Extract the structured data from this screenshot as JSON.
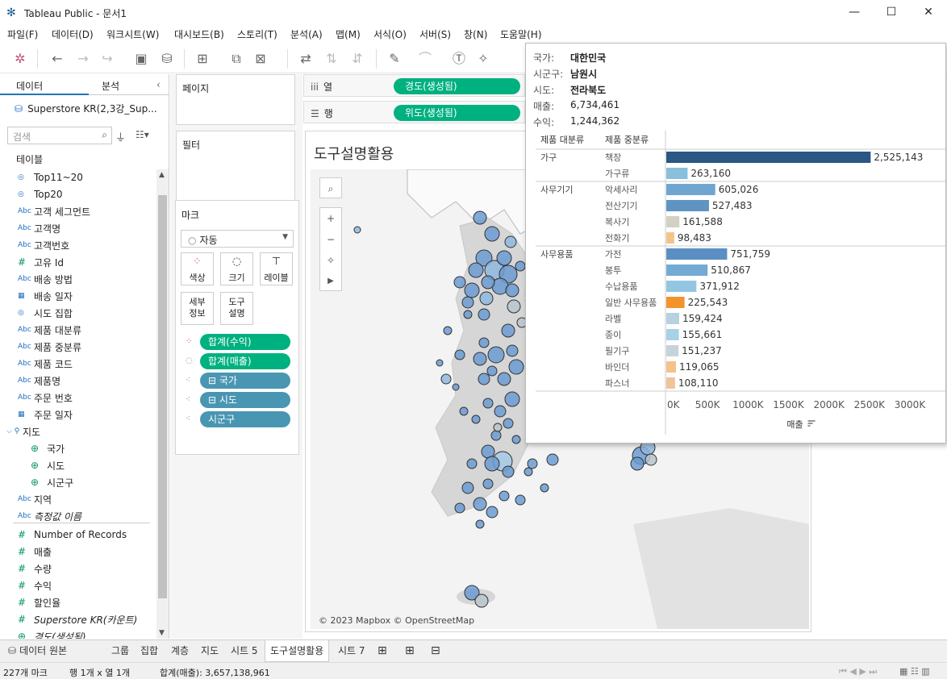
{
  "window": {
    "title": "Tableau Public - 문서1",
    "minimize": "—",
    "maximize": "☐",
    "close": "✕"
  },
  "menu": [
    "파일(F)",
    "데이터(D)",
    "워크시트(W)",
    "대시보드(B)",
    "스토리(T)",
    "분석(A)",
    "맵(M)",
    "서식(O)",
    "서버(S)",
    "창(N)",
    "도움말(H)"
  ],
  "toolbar": {
    "icons": [
      "tableau-logo-icon",
      "back-icon",
      "forward-icon",
      "redo-icon",
      "save-icon",
      "new-datasource-icon",
      "new-worksheet-icon",
      "duplicate-icon",
      "clear-icon",
      "swap-icon",
      "sort-asc-icon",
      "sort-desc-icon",
      "highlight-icon",
      "annotate-icon",
      "text-icon",
      "pin-icon"
    ]
  },
  "left_pane": {
    "tab_data": "데이터",
    "tab_analysis": "분석",
    "collapse": "‹",
    "datasource": "Superstore KR(2,3강_Sup...",
    "search_placeholder": "검색",
    "tables_header": "테이블",
    "fields": [
      {
        "icon": "set",
        "label": "Top11~20"
      },
      {
        "icon": "set",
        "label": "Top20"
      },
      {
        "icon": "Abc",
        "label": "고객 세그먼트"
      },
      {
        "icon": "Abc",
        "label": "고객명"
      },
      {
        "icon": "Abc",
        "label": "고객번호"
      },
      {
        "icon": "#",
        "label": "고유 Id"
      },
      {
        "icon": "Abc",
        "label": "배송 방법"
      },
      {
        "icon": "date",
        "label": "배송 일자"
      },
      {
        "icon": "set",
        "label": "시도 집합"
      },
      {
        "icon": "Abc",
        "label": "제품 대분류"
      },
      {
        "icon": "Abc",
        "label": "제품 중분류"
      },
      {
        "icon": "Abc",
        "label": "제품 코드"
      },
      {
        "icon": "Abc",
        "label": "제품명"
      },
      {
        "icon": "Abc",
        "label": "주문 번호"
      },
      {
        "icon": "date",
        "label": "주문 일자"
      },
      {
        "icon": "hier",
        "label": "지도"
      },
      {
        "icon": "geo",
        "label": "국가"
      },
      {
        "icon": "geo",
        "label": "시도"
      },
      {
        "icon": "geo",
        "label": "시군구"
      },
      {
        "icon": "Abc",
        "label": "지역"
      },
      {
        "icon": "Abc",
        "label": "측정값 이름"
      },
      {
        "icon": "#",
        "label": "Number of Records"
      },
      {
        "icon": "#",
        "label": "매출"
      },
      {
        "icon": "#",
        "label": "수량"
      },
      {
        "icon": "#",
        "label": "수익"
      },
      {
        "icon": "#",
        "label": "할인율"
      },
      {
        "icon": "#",
        "label": "Superstore KR(카운트)"
      },
      {
        "icon": "geo",
        "label": "경도(생성됨)"
      }
    ]
  },
  "mid_pane": {
    "pages": "페이지",
    "filters": "필터",
    "marks": "마크",
    "mark_type": "자동",
    "buttons": [
      "색상",
      "크기",
      "레이블",
      "세부\n정보",
      "도구\n설명"
    ],
    "pills": [
      "합계(수익)",
      "합계(매출)",
      "⊟ 국가",
      "⊟ 시도",
      "시군구"
    ]
  },
  "shelves": {
    "columns_label": "열",
    "rows_label": "행",
    "columns_pill": "경도(생성됨)",
    "rows_pill": "위도(생성됨)"
  },
  "sheet": {
    "title": "도구설명활용",
    "copyright": "© 2023 Mapbox © OpenStreetMap"
  },
  "tooltip": {
    "country_key": "국가:",
    "country": "대한민국",
    "city_key": "시군구:",
    "city": "남원시",
    "province_key": "시도:",
    "province": "전라북도",
    "sales_key": "매출:",
    "sales": "6,734,461",
    "profit_key": "수익:",
    "profit": "1,244,362",
    "col1": "제품 대분류",
    "col2": "제품 중분류",
    "axis_title": "매출"
  },
  "chart_data": {
    "type": "bar",
    "orientation": "horizontal",
    "groups": [
      {
        "name": "가구",
        "items": [
          {
            "label": "책장",
            "value": 2525143,
            "color": "#2a5783"
          },
          {
            "label": "가구류",
            "value": 263160,
            "color": "#89bfdc"
          }
        ]
      },
      {
        "name": "사무기기",
        "items": [
          {
            "label": "악세사리",
            "value": 605026,
            "color": "#6fa6d0"
          },
          {
            "label": "전산기기",
            "value": 527483,
            "color": "#5f93c2"
          },
          {
            "label": "복사기",
            "value": 161588,
            "color": "#d4d0c4"
          },
          {
            "label": "전화기",
            "value": 98483,
            "color": "#f3c38c"
          }
        ]
      },
      {
        "name": "사무용품",
        "items": [
          {
            "label": "가전",
            "value": 751759,
            "color": "#5b8fc4"
          },
          {
            "label": "봉투",
            "value": 510867,
            "color": "#73aad4"
          },
          {
            "label": "수납용품",
            "value": 371912,
            "color": "#93c6e3"
          },
          {
            "label": "일반 사무용품",
            "value": 225543,
            "color": "#f2932e"
          },
          {
            "label": "라벨",
            "value": 159424,
            "color": "#b7d2df"
          },
          {
            "label": "종이",
            "value": 155661,
            "color": "#a8d0e6"
          },
          {
            "label": "필기구",
            "value": 151237,
            "color": "#c6d4da"
          },
          {
            "label": "바인더",
            "value": 119065,
            "color": "#f3c38c"
          },
          {
            "label": "파스너",
            "value": 108110,
            "color": "#eec49a"
          }
        ]
      }
    ],
    "value_labels": [
      "2,525,143",
      "263,160",
      "605,026",
      "527,483",
      "161,588",
      "98,483",
      "751,759",
      "510,867",
      "371,912",
      "225,543",
      "159,424",
      "155,661",
      "151,237",
      "119,065",
      "108,110"
    ],
    "xticks": [
      0,
      500000,
      1000000,
      1500000,
      2000000,
      2500000,
      3000000
    ],
    "xtick_labels": [
      "0K",
      "500K",
      "1000K",
      "1500K",
      "2000K",
      "2500K",
      "3000K"
    ],
    "xlim": [
      0,
      3000000
    ],
    "xlabel": "매출"
  },
  "bottom_tabs": {
    "datasource": "데이터 원본",
    "tabs": [
      "그룹",
      "집합",
      "계층",
      "지도",
      "시트 5",
      "도구설명활용",
      "시트 7"
    ],
    "active": "도구설명활용"
  },
  "status": {
    "marks": "227개 마크",
    "rowcol": "행 1개  x  열 1개",
    "sum": "합계(매출): 3,657,138,961"
  }
}
